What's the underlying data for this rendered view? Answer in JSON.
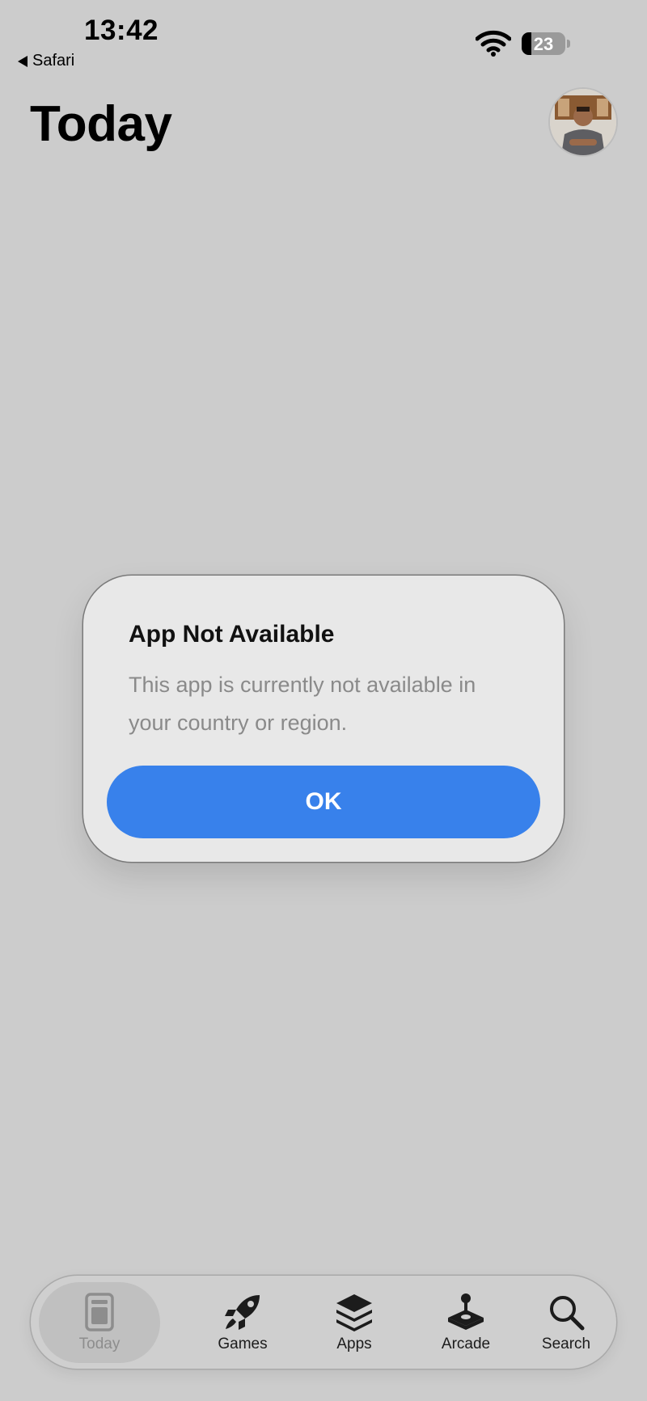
{
  "status_bar": {
    "time": "13:42",
    "back_app": "Safari",
    "battery_level": "23",
    "battery_fraction": 0.23
  },
  "header": {
    "title": "Today"
  },
  "alert": {
    "title": "App Not Available",
    "message": "This app is currently not available in your country or region.",
    "ok_label": "OK"
  },
  "tab_bar": {
    "tabs": [
      {
        "label": "Today",
        "icon": "today-icon",
        "active": true
      },
      {
        "label": "Games",
        "icon": "rocket-icon",
        "active": false
      },
      {
        "label": "Apps",
        "icon": "layers-icon",
        "active": false
      },
      {
        "label": "Arcade",
        "icon": "joystick-icon",
        "active": false
      },
      {
        "label": "Search",
        "icon": "search-icon",
        "active": false
      }
    ]
  },
  "colors": {
    "background": "#cccccc",
    "accent": "#3881eb",
    "alert_bg": "#e8e8e8"
  }
}
